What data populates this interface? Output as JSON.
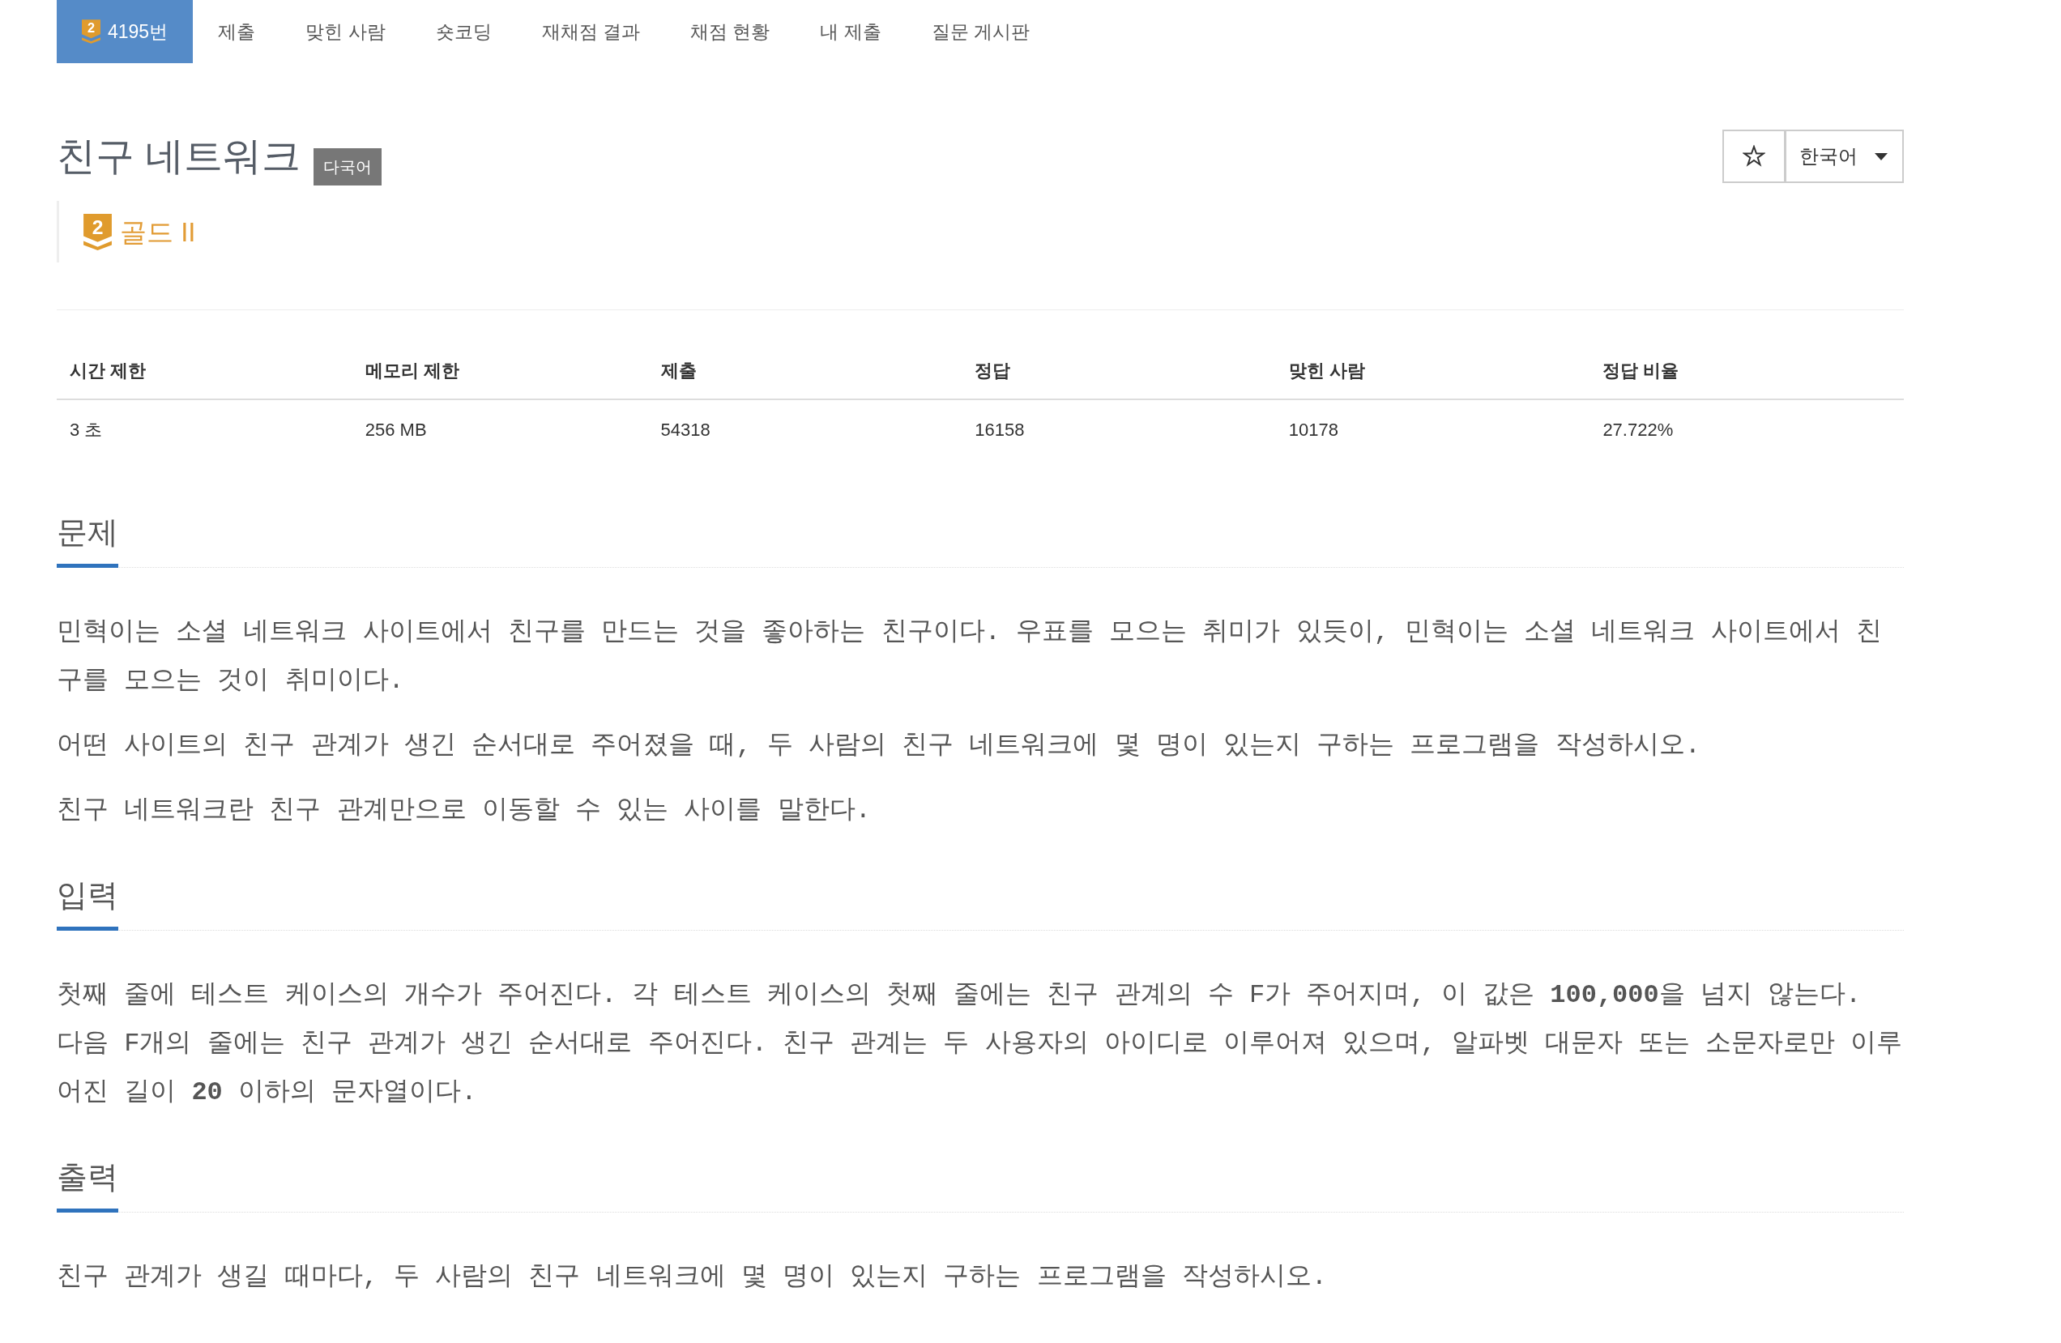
{
  "nav": {
    "tabs": [
      {
        "label": "4195번",
        "selected": true,
        "tier_digit": "2"
      },
      {
        "label": "제출",
        "selected": false
      },
      {
        "label": "맞힌 사람",
        "selected": false
      },
      {
        "label": "숏코딩",
        "selected": false
      },
      {
        "label": "재채점 결과",
        "selected": false
      },
      {
        "label": "채점 현황",
        "selected": false
      },
      {
        "label": "내 제출",
        "selected": false
      },
      {
        "label": "질문 게시판",
        "selected": false
      }
    ]
  },
  "problem": {
    "title": "친구 네트워크",
    "tag": "다국어",
    "tier": {
      "digit": "2",
      "label": "골드 II"
    }
  },
  "toolbar": {
    "language": "한국어"
  },
  "limits_table": {
    "columns": [
      "시간 제한",
      "메모리 제한",
      "제출",
      "정답",
      "맞힌 사람",
      "정답 비율"
    ],
    "rows": [
      [
        "3 초",
        "256 MB",
        "54318",
        "16158",
        "10178",
        "27.722%"
      ]
    ]
  },
  "sections": [
    {
      "heading": "문제",
      "paragraphs": [
        "민혁이는 소셜 네트워크 사이트에서 친구를 만드는 것을 좋아하는 친구이다. 우표를 모으는 취미가 있듯이, 민혁이는 소셜 네트워크 사이트에서 친구를 모으는 것이 취미이다.",
        "어떤 사이트의 친구 관계가 생긴 순서대로 주어졌을 때, 두 사람의 친구 네트워크에 몇 명이 있는지 구하는 프로그램을 작성하시오.",
        "친구 네트워크란 친구 관계만으로 이동할 수 있는 사이를 말한다."
      ]
    },
    {
      "heading": "입력",
      "paragraphs": [
        "첫째 줄에 테스트 케이스의 개수가 주어진다. 각 테스트 케이스의 첫째 줄에는 친구 관계의 수 F가 주어지며, 이 값은 **100,000**을 넘지 않는다.\n다음 F개의 줄에는 친구 관계가 생긴 순서대로 주어진다. 친구 관계는 두 사용자의 아이디로 이루어져 있으며, 알파벳 대문자 또는 소문자로만 이루어진 길이 **20** 이하의 문자열이다."
      ]
    },
    {
      "heading": "출력",
      "paragraphs": [
        "친구 관계가 생길 때마다, 두 사람의 친구 네트워크에 몇 명이 있는지 구하는 프로그램을 작성하시오."
      ]
    }
  ]
}
